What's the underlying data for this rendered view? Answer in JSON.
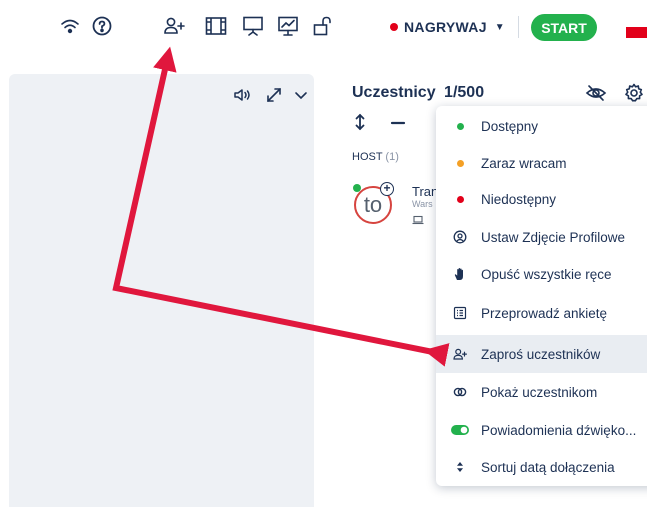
{
  "topbar": {
    "icons": [
      "wifi-icon",
      "help-icon",
      "add-user-icon",
      "layout-icon",
      "presentation-icon",
      "chart-icon",
      "unlock-icon"
    ],
    "record_label": "NAGRYWAJ",
    "start_label": "START"
  },
  "colors": {
    "record_dot": "#e2001a",
    "start_bg": "#23b14d",
    "text_dark": "#1d3154",
    "status_available": "#23b14d",
    "status_away": "#f4a025",
    "status_unavailable": "#e2001a",
    "arrow": "#e0173d"
  },
  "participants": {
    "title": "Uczestnicy",
    "count": "1/500",
    "host_label": "HOST",
    "host_count": "(1)",
    "avatar_text": "to",
    "name_partial": "Tran",
    "location_partial": "Wars"
  },
  "menu": {
    "items": [
      {
        "label": "Dostępny",
        "icon": "status-dot-green"
      },
      {
        "label": "Zaraz wracam",
        "icon": "status-dot-orange"
      },
      {
        "label": "Niedostępny",
        "icon": "status-dot-red"
      },
      {
        "label": "Ustaw Zdjęcie Profilowe",
        "icon": "profile-photo-icon"
      },
      {
        "label": "Opuść wszystkie ręce",
        "icon": "hand-icon"
      },
      {
        "label": "Przeprowadź ankietę",
        "icon": "poll-icon"
      },
      {
        "label": "Zaproś uczestników",
        "icon": "add-user-icon"
      },
      {
        "label": "Pokaż uczestnikom",
        "icon": "show-icon"
      },
      {
        "label": "Powiadomienia dźwięko...",
        "icon": "toggle-on-icon"
      },
      {
        "label": "Sortuj datą dołączenia",
        "icon": "sort-icon"
      }
    ]
  }
}
